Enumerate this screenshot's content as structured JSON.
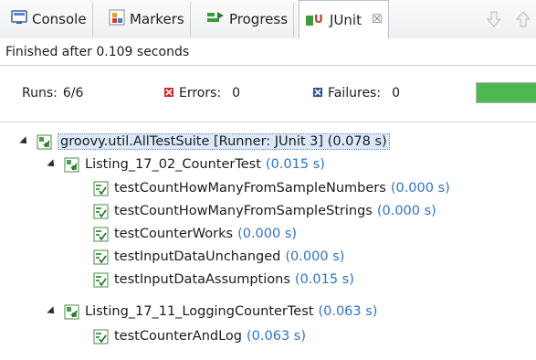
{
  "tabs": [
    {
      "label": "Console",
      "icon": "console-icon"
    },
    {
      "label": "Markers",
      "icon": "markers-icon"
    },
    {
      "label": "Progress",
      "icon": "progress-icon"
    },
    {
      "label": "JUnit",
      "icon": "junit-icon",
      "active": true,
      "close": "☒"
    }
  ],
  "toolbar": {
    "down_icon": "arrow-down-icon",
    "up_icon": "arrow-up-icon"
  },
  "status": {
    "text": "Finished after 0.109 seconds"
  },
  "counters": {
    "runs_label": "Runs:",
    "runs_value": "6/6",
    "errors_label": "Errors:",
    "errors_value": "0",
    "failures_label": "Failures:",
    "failures_value": "0",
    "progress": 1.0
  },
  "tree": {
    "suite": {
      "name": "groovy.util.AllTestSuite [Runner: JUnit 3] (0.078 s)"
    },
    "classes": [
      {
        "name": "Listing_17_02_CounterTest",
        "time": "(0.015 s)",
        "tests": [
          {
            "name": "testCountHowManyFromSampleNumbers",
            "time": "(0.000 s)"
          },
          {
            "name": "testCountHowManyFromSampleStrings",
            "time": "(0.000 s)"
          },
          {
            "name": "testCounterWorks",
            "time": "(0.000 s)"
          },
          {
            "name": "testInputDataUnchanged",
            "time": "(0.000 s)"
          },
          {
            "name": "testInputDataAssumptions",
            "time": "(0.015 s)"
          }
        ]
      },
      {
        "name": "Listing_17_11_LoggingCounterTest",
        "time": "(0.063 s)",
        "tests": [
          {
            "name": "testCounterAndLog",
            "time": "(0.063 s)"
          }
        ]
      }
    ]
  },
  "colors": {
    "time": "#2f72c8",
    "pass": "#3a9a3a",
    "error": "#d12b2b",
    "failure": "#2a4f9b"
  }
}
